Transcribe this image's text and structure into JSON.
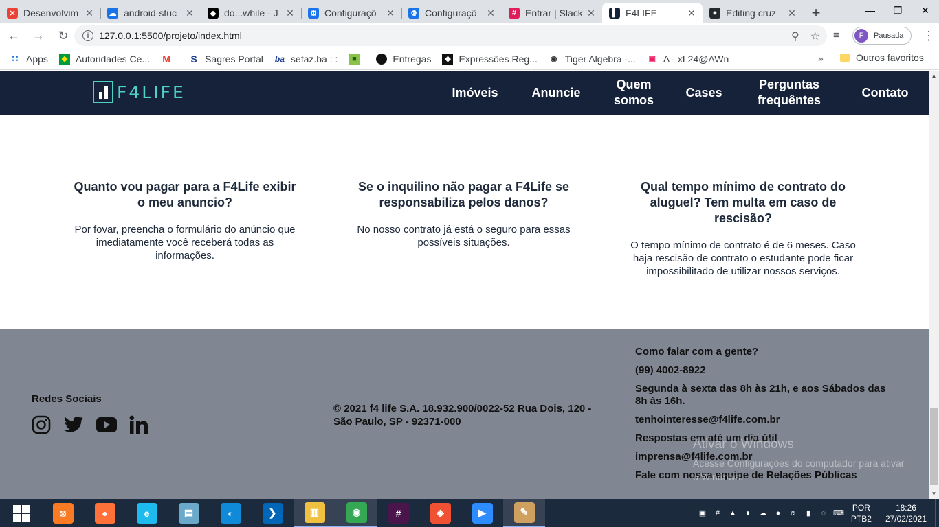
{
  "browser": {
    "tabs": [
      {
        "title": "Desenvolvim",
        "color": "#ea4335",
        "glyph": "✕"
      },
      {
        "title": "android-stuc",
        "color": "#1a73e8",
        "glyph": "☁"
      },
      {
        "title": "do...while - J",
        "color": "#000000",
        "glyph": "◆"
      },
      {
        "title": "Configuraçõ",
        "color": "#1a73e8",
        "glyph": "⚙"
      },
      {
        "title": "Configuraçõ",
        "color": "#1a73e8",
        "glyph": "⚙"
      },
      {
        "title": "Entrar | Slack",
        "color": "#e01e5a",
        "glyph": "#"
      },
      {
        "title": "F4LIFE",
        "color": "#15223a",
        "glyph": "▌",
        "active": true
      },
      {
        "title": "Editing cruz",
        "color": "#24292e",
        "glyph": "●"
      }
    ],
    "url": "127.0.0.1:5500/projeto/index.html",
    "profile_initial": "F",
    "profile_status": "Pausada",
    "bookmarks": [
      {
        "label": "Apps",
        "icon": "apps-icon"
      },
      {
        "label": "Autoridades Ce...",
        "icon": "flag-icon"
      },
      {
        "label": "",
        "icon": "gmail-icon"
      },
      {
        "label": "Sagres Portal",
        "icon": "sagres-icon"
      },
      {
        "label": "sefaz.ba : :",
        "icon": "sefaz-icon"
      },
      {
        "label": "",
        "icon": "green-square-icon"
      },
      {
        "label": "Entregas",
        "icon": "circle-icon"
      },
      {
        "label": "Expressões Reg...",
        "icon": "diamond-icon"
      },
      {
        "label": "Tiger Algebra -...",
        "icon": "tiger-icon"
      },
      {
        "label": "A - xL24@AWn",
        "icon": "cube-icon"
      }
    ],
    "bookmarks_more": "»",
    "other_bookmarks": "Outros favoritos"
  },
  "site": {
    "logo_text": "F4LIFE",
    "nav": [
      {
        "label": "Imóveis"
      },
      {
        "label": "Anuncie"
      },
      {
        "label": "Quem somos"
      },
      {
        "label": "Cases"
      },
      {
        "label": "Perguntas frequêntes"
      },
      {
        "label": "Contato"
      }
    ],
    "faq": [
      {
        "question": "Quanto vou pagar para a F4Life exibir o meu anuncio?",
        "answer": "Por fovar, preencha o formulário do anúncio que imediatamente você receberá todas as informações."
      },
      {
        "question": "Se o inquilino não pagar a F4Life se responsabiliza pelos danos?",
        "answer": "No nosso contrato já está o seguro para essas possíveis situações."
      },
      {
        "question": "Qual tempo mínimo de contrato do aluguel? Tem multa em caso de rescisão?",
        "answer": "O tempo mínimo de contrato é de 6 meses. Caso haja rescisão de contrato o estudante pode ficar impossibilitado de utilizar nossos serviços."
      }
    ],
    "footer": {
      "social_title": "Redes Sociais",
      "copyright": "© 2021 f4 life S.A. 18.932.900/0022-52 Rua Dois, 120 - São Paulo, SP - 92371-000",
      "contact": [
        "Como falar com a gente?",
        "(99) 4002-8922",
        "Segunda à sexta das 8h às 21h, e aos Sábados das 8h às 16h.",
        "tenhointeresse@f4life.com.br",
        "Respostas em até um dia útil",
        "imprensa@f4life.com.br",
        "Fale com nossa equipe de Relações Públicas"
      ]
    },
    "watermark": {
      "title": "Ativar o Windows",
      "subtitle": "Acesse Configurações do computador para ativar o Windows."
    }
  },
  "taskbar": {
    "apps": [
      {
        "name": "xampp",
        "color": "#fb7a24",
        "glyph": "⦻"
      },
      {
        "name": "firefox",
        "color": "#ff7139",
        "glyph": "●"
      },
      {
        "name": "internet-explorer",
        "color": "#1ebbee",
        "glyph": "e"
      },
      {
        "name": "notepad",
        "color": "#6aa9c9",
        "glyph": "▤"
      },
      {
        "name": "edge",
        "color": "#0f8ad8",
        "glyph": "◐"
      },
      {
        "name": "vscode",
        "color": "#0066b8",
        "glyph": "❯"
      },
      {
        "name": "file-explorer",
        "color": "#f0c040",
        "glyph": "▥",
        "open": true
      },
      {
        "name": "chrome",
        "color": "#34a853",
        "glyph": "◉",
        "open": true
      },
      {
        "name": "slack",
        "color": "#4a154b",
        "glyph": "#"
      },
      {
        "name": "git",
        "color": "#f05133",
        "glyph": "◈"
      },
      {
        "name": "zoom",
        "color": "#2d8cff",
        "glyph": "▶"
      },
      {
        "name": "paint",
        "color": "#d0a060",
        "glyph": "✎",
        "open": true
      }
    ],
    "lang_top": "POR",
    "lang_bottom": "PTB2",
    "time": "18:26",
    "date": "27/02/2021"
  }
}
